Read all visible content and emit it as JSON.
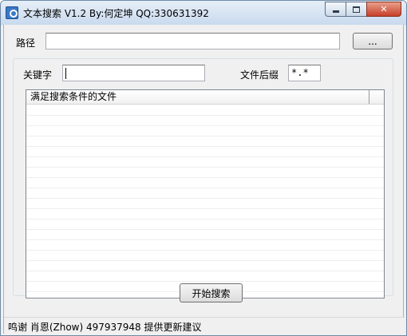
{
  "window": {
    "title": "文本搜索 V1.2  By:何定坤 QQ:330631392"
  },
  "form": {
    "path_label": "路径",
    "path_value": "",
    "browse_label": "...",
    "keyword_label": "关键字",
    "keyword_value": "",
    "ext_label": "文件后缀",
    "ext_value": "*.*"
  },
  "results": {
    "column_header": "满足搜索条件的文件",
    "rows": []
  },
  "actions": {
    "search_label": "开始搜索"
  },
  "status": {
    "text": "鸣谢 肖恩(Zhow) 497937948 提供更新建议"
  },
  "colors": {
    "close_button": "#c7402a",
    "title_gradient_top": "#e6eef8",
    "title_gradient_bottom": "#c9daee"
  }
}
